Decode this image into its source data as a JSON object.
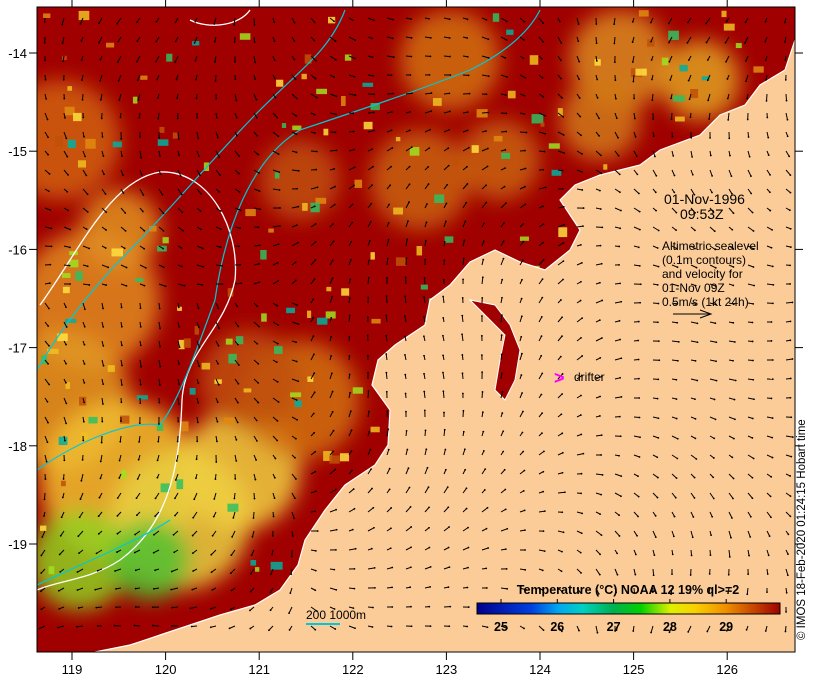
{
  "map": {
    "date": "01-Nov-1996",
    "time": "09:53Z",
    "legend_lines": [
      "Altimetric sealevel",
      "(0.1m contours)",
      "and velocity for",
      "01-Nov 09Z",
      "0.5m/s (1kt 24h)"
    ],
    "drifter_label": "drifter",
    "drifter_symbol": ">",
    "bathy_label": "200  1000m",
    "copyright": "© IMOS 18-Feb-2020 01:24:15 Hobart time",
    "lon_ticks": [
      "119",
      "120",
      "121",
      "122",
      "123",
      "124",
      "125",
      "126"
    ],
    "lat_ticks": [
      "-14",
      "-15",
      "-16",
      "-17",
      "-18",
      "-19"
    ],
    "colors": {
      "land": "#fccc98",
      "sea_warm": "#a00000",
      "drifter": "#ff00ff",
      "contour_sealevel": "#ffffff",
      "contour_bathy": "#00c8d8"
    }
  },
  "colorbar": {
    "title": "Temperature (°C) NOAA 12 19% ql>=2",
    "ticks": [
      "25",
      "26",
      "27",
      "28",
      "29"
    ],
    "range": [
      24.6,
      29.8
    ]
  }
}
